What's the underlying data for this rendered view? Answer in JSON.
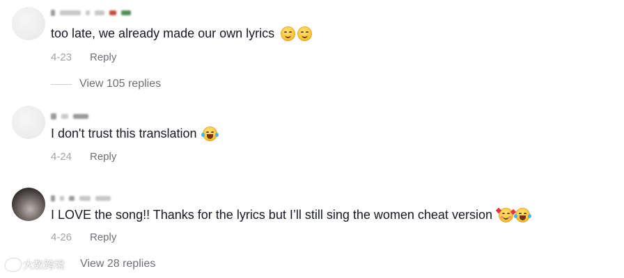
{
  "comments": [
    {
      "text": "too late, we already made our own lyrics",
      "emojis": [
        "smiling-face-icon",
        "smiling-face-icon"
      ],
      "date": "4-23",
      "reply_label": "Reply",
      "view_replies": "View 105 replies"
    },
    {
      "text": "I don't trust this translation",
      "emojis": [
        "tears-of-joy-icon"
      ],
      "date": "4-24",
      "reply_label": "Reply"
    },
    {
      "text": "I LOVE the song!! Thanks for the lyrics but I’ll still sing the women cheat version",
      "emojis": [
        "smiling-face-with-hearts-icon",
        "tears-of-joy-icon"
      ],
      "date": "4-26",
      "reply_label": "Reply",
      "view_replies": "View 28 replies"
    }
  ],
  "watermark": {
    "text": "大数跨境"
  },
  "colors": {
    "primary_text": "#161823",
    "secondary_text": "#6e7076",
    "date_text": "#a0a3a8"
  }
}
